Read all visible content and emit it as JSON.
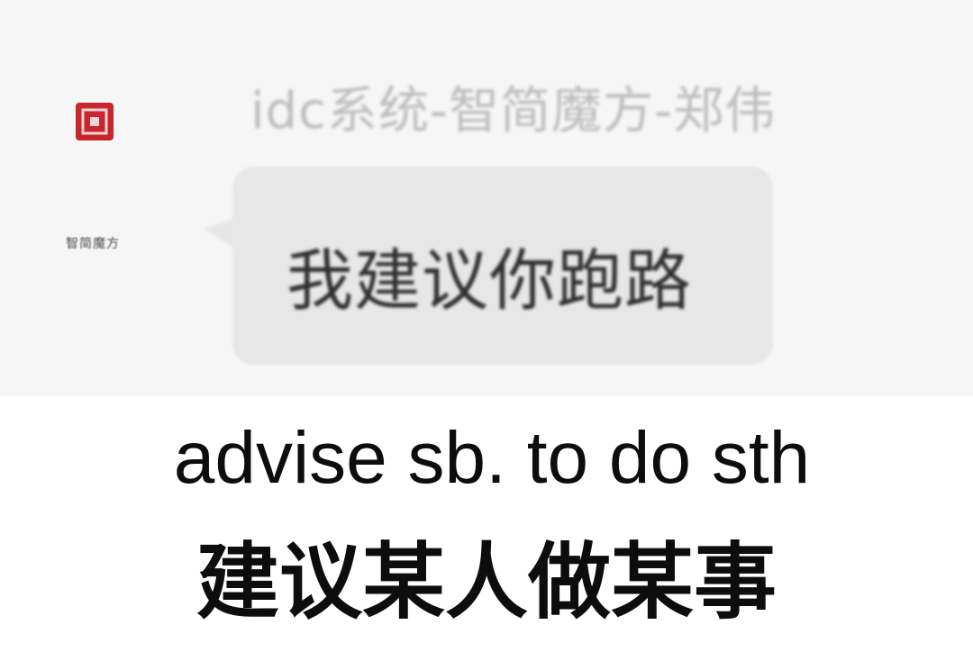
{
  "chat": {
    "sender_name": "idc系统-智简魔方-郑伟",
    "message": "我建议你跑路",
    "avatar": {
      "icon": "red-square-logo-icon",
      "name": "智简魔方",
      "sub": "",
      "brand_color": "#c8252c"
    },
    "bubble_color": "#e7e7e7"
  },
  "caption": {
    "english": "advise sb. to do sth",
    "chinese": "建议某人做某事"
  }
}
